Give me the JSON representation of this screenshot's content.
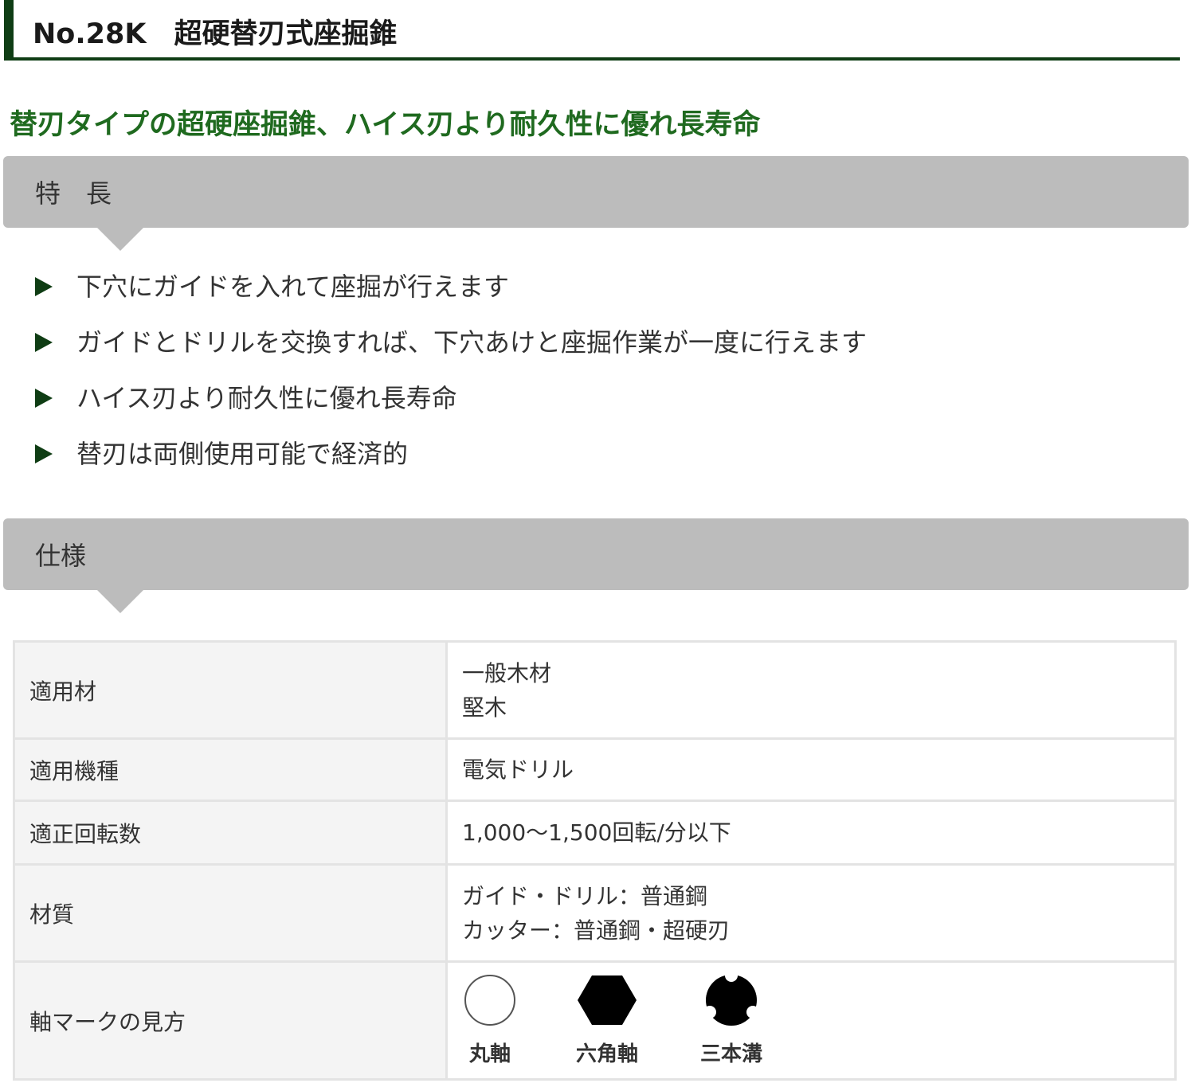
{
  "header": {
    "title": "No.28K　超硬替刃式座掘錐"
  },
  "catchphrase": "替刃タイプの超硬座掘錐、ハイス刃より耐久性に優れ長寿命",
  "features": {
    "heading": "特　長",
    "items": [
      "下穴にガイドを入れて座掘が行えます",
      "ガイドとドリルを交換すれば、下穴あけと座掘作業が一度に行えます",
      "ハイス刃より耐久性に優れ長寿命",
      "替刃は両側使用可能で経済的"
    ]
  },
  "spec": {
    "heading": "仕様",
    "rows": [
      {
        "label": "適用材",
        "lines": [
          "一般木材",
          "堅木"
        ]
      },
      {
        "label": "適用機種",
        "lines": [
          "電気ドリル"
        ]
      },
      {
        "label": "適正回転数",
        "lines": [
          "1,000～1,500回転/分以下"
        ]
      },
      {
        "label": "材質",
        "lines": [
          "ガイド・ドリル：普通鋼",
          "カッター：普通鋼・超硬刃"
        ]
      },
      {
        "label": "軸マークの見方"
      }
    ],
    "shaft_marks": [
      {
        "icon": "round-shaft-icon",
        "label": "丸軸"
      },
      {
        "icon": "hex-shaft-icon",
        "label": "六角軸"
      },
      {
        "icon": "three-groove-shaft-icon",
        "label": "三本溝"
      }
    ]
  },
  "colors": {
    "title_bar": "#0f3d14",
    "catchphrase": "#1f6a1f",
    "section_header_bg": "#bcbcbc",
    "table_border": "#e3e3e3",
    "table_label_bg": "#f4f4f4"
  }
}
